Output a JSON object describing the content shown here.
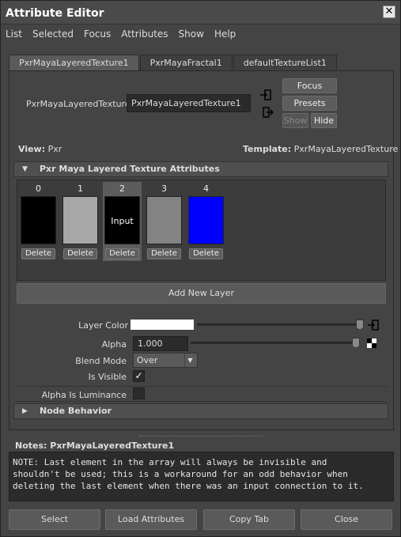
{
  "window": {
    "title": "Attribute Editor",
    "close_glyph": "✕"
  },
  "menu": [
    "List",
    "Selected",
    "Focus",
    "Attributes",
    "Show",
    "Help"
  ],
  "tabs": [
    "PxrMayaLayeredTexture1",
    "PxrMayaFractal1",
    "defaultTextureList1"
  ],
  "node": {
    "label": "PxrMayaLayeredTexture:",
    "value": "PxrMayaLayeredTexture1"
  },
  "side_buttons": {
    "focus": "Focus",
    "presets": "Presets",
    "show": "Show",
    "hide": "Hide"
  },
  "view": {
    "label": "View:",
    "value": "Pxr"
  },
  "template": {
    "label": "Template:",
    "value": "PxrMayaLayeredTexture"
  },
  "section_main": "Pxr Maya Layered Texture Attributes",
  "layers": [
    {
      "index": "0",
      "color": "#000000",
      "text": "",
      "delete": "Delete"
    },
    {
      "index": "1",
      "color": "#a8a8a8",
      "text": "",
      "delete": "Delete"
    },
    {
      "index": "2",
      "color": "#000000",
      "text": "Input",
      "delete": "Delete"
    },
    {
      "index": "3",
      "color": "#838383",
      "text": "",
      "delete": "Delete"
    },
    {
      "index": "4",
      "color": "#0000ff",
      "text": "",
      "delete": "Delete"
    }
  ],
  "add_layer": "Add New Layer",
  "attrs": {
    "layer_color": {
      "label": "Layer Color",
      "value": "#ffffff"
    },
    "alpha": {
      "label": "Alpha",
      "value": "1.000"
    },
    "blend_mode": {
      "label": "Blend Mode",
      "value": "Over"
    },
    "is_visible": {
      "label": "Is Visible",
      "checked": "✓"
    },
    "alpha_is_luminance": {
      "label": "Alpha Is Luminance"
    }
  },
  "section_node": "Node Behavior",
  "notes": {
    "label": "Notes:  PxrMayaLayeredTexture1",
    "text": "NOTE: Last element in the array will always be invisible and\nshouldn't be used; this is a workaround for an odd behavior when\ndeleting the last element when there was an input connection to it."
  },
  "bottom_buttons": [
    "Select",
    "Load Attributes",
    "Copy Tab",
    "Close"
  ]
}
